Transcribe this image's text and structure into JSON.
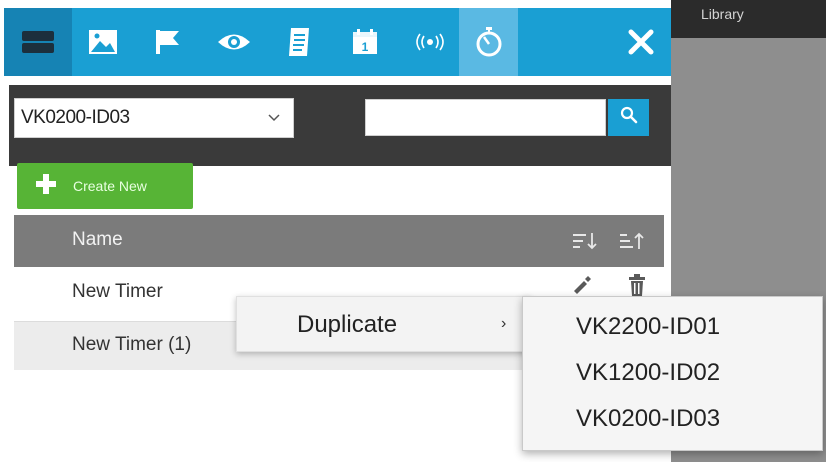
{
  "library": {
    "label": "Library"
  },
  "toolbar": {
    "icons": [
      "layers-icon",
      "image-icon",
      "flag-icon",
      "eye-icon",
      "document-icon",
      "calendar-icon",
      "broadcast-icon",
      "stopwatch-icon",
      "close-icon"
    ],
    "calendar_day": "1"
  },
  "filter": {
    "device_value": "VK0200-ID03",
    "search_value": "",
    "search_placeholder": ""
  },
  "create_button": {
    "label": "Create New"
  },
  "list": {
    "header": "Name",
    "rows": [
      {
        "name": "New Timer"
      },
      {
        "name": "New Timer (1)"
      }
    ]
  },
  "context_menu": {
    "label": "Duplicate",
    "arrow": "›"
  },
  "submenu": {
    "items": [
      "VK2200-ID01",
      "VK1200-ID02",
      "VK0200-ID03"
    ]
  },
  "colors": {
    "toolbar": "#1a9fd3",
    "toolbar_active": "#1683b4",
    "toolbar_selected": "#5ab9e3",
    "create_button": "#57b436",
    "list_header": "#7b7b7b",
    "panel_dark": "#3a3a3a",
    "library_panel": "#8e8e8e"
  }
}
